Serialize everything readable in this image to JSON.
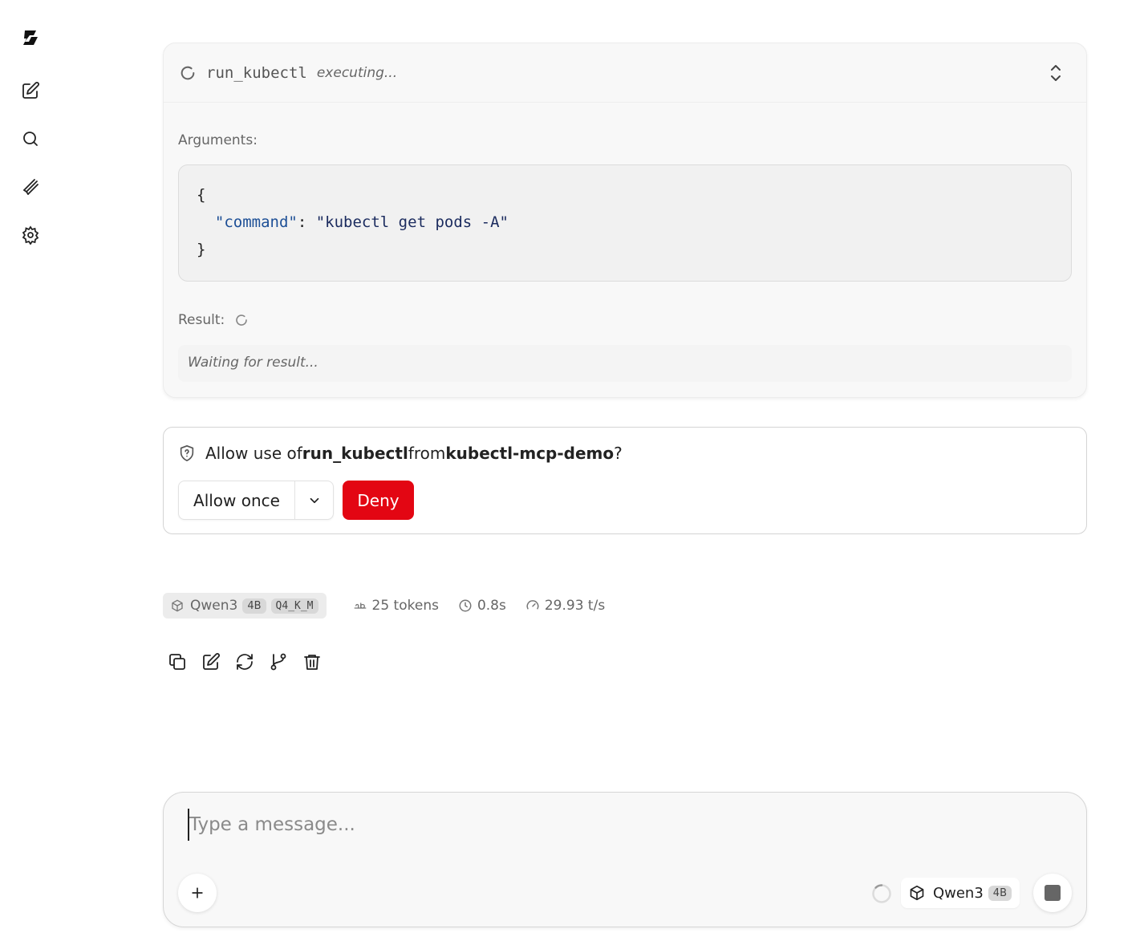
{
  "sidebar": {
    "items": [
      {
        "icon": "logo-icon"
      },
      {
        "icon": "new-chat-icon"
      },
      {
        "icon": "search-icon"
      },
      {
        "icon": "paperclip-icon"
      },
      {
        "icon": "settings-icon"
      }
    ]
  },
  "tool_call": {
    "name": "run_kubectl",
    "status": "executing...",
    "arguments_label": "Arguments:",
    "arguments": {
      "open": "{",
      "key": "\"command\"",
      "sep": ": ",
      "value": "\"kubectl get pods -A\"",
      "close": "}"
    },
    "result_label": "Result:",
    "result_placeholder": "Waiting for result..."
  },
  "permission": {
    "prefix": "Allow use of ",
    "tool": "run_kubectl",
    "middle": "from ",
    "server": "kubectl-mcp-demo",
    "suffix": "?",
    "allow_label": "Allow once",
    "deny_label": "Deny",
    "deny_color": "#e30613"
  },
  "stats": {
    "model": "Qwen3",
    "size_badge": "4B",
    "quant_badge": "Q4_K_M",
    "tokens": "25 tokens",
    "time": "0.8s",
    "speed": "29.93 t/s"
  },
  "actions": [
    "copy-icon",
    "edit-icon",
    "regenerate-icon",
    "branch-icon",
    "delete-icon"
  ],
  "composer": {
    "placeholder": "Type a message...",
    "model": "Qwen3",
    "model_badge": "4B"
  }
}
